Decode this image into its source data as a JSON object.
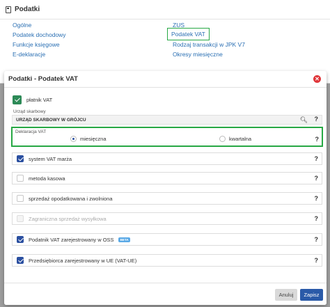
{
  "background": {
    "title": "Podatki",
    "links_left": [
      "Ogólne",
      "Podatek dochodowy",
      "Funkcje księgowe",
      "E-deklaracje"
    ],
    "links_right": [
      "ZUS",
      "Podatek VAT",
      "Rodzaj transakcji w JPK V7",
      "Okresy miesięczne"
    ]
  },
  "modal": {
    "title": "Podatki - Podatek VAT",
    "platnik_vat": "płatnik VAT",
    "urzad_label": "Urząd skarbowy",
    "urzad_value": "URZĄD SKARBOWY W GRÓJCU",
    "deklaracja_label": "Deklaracja VAT",
    "radio_monthly": "miesięczna",
    "radio_quarterly": "kwartalna",
    "help": "?",
    "options": [
      {
        "label": "system VAT marża",
        "checked": true
      },
      {
        "label": "metoda kasowa",
        "checked": false
      },
      {
        "label": "sprzedaż opodatkowana i zwolniona",
        "checked": false
      },
      {
        "label": "Zagraniczna sprzedaż wysyłkowa",
        "checked": false,
        "disabled": true
      },
      {
        "label": "Podatnik VAT zarejestrowany w OSS",
        "checked": true,
        "badge": "BETA"
      },
      {
        "label": "Przedsiębiorca zarejestrowany w UE (VAT-UE)",
        "checked": true
      }
    ],
    "cancel_label": "Anuluj",
    "save_label": "Zapisz"
  },
  "colors": {
    "accent": "#2a5aa8",
    "highlight": "#27a844",
    "close": "#e0363a"
  }
}
